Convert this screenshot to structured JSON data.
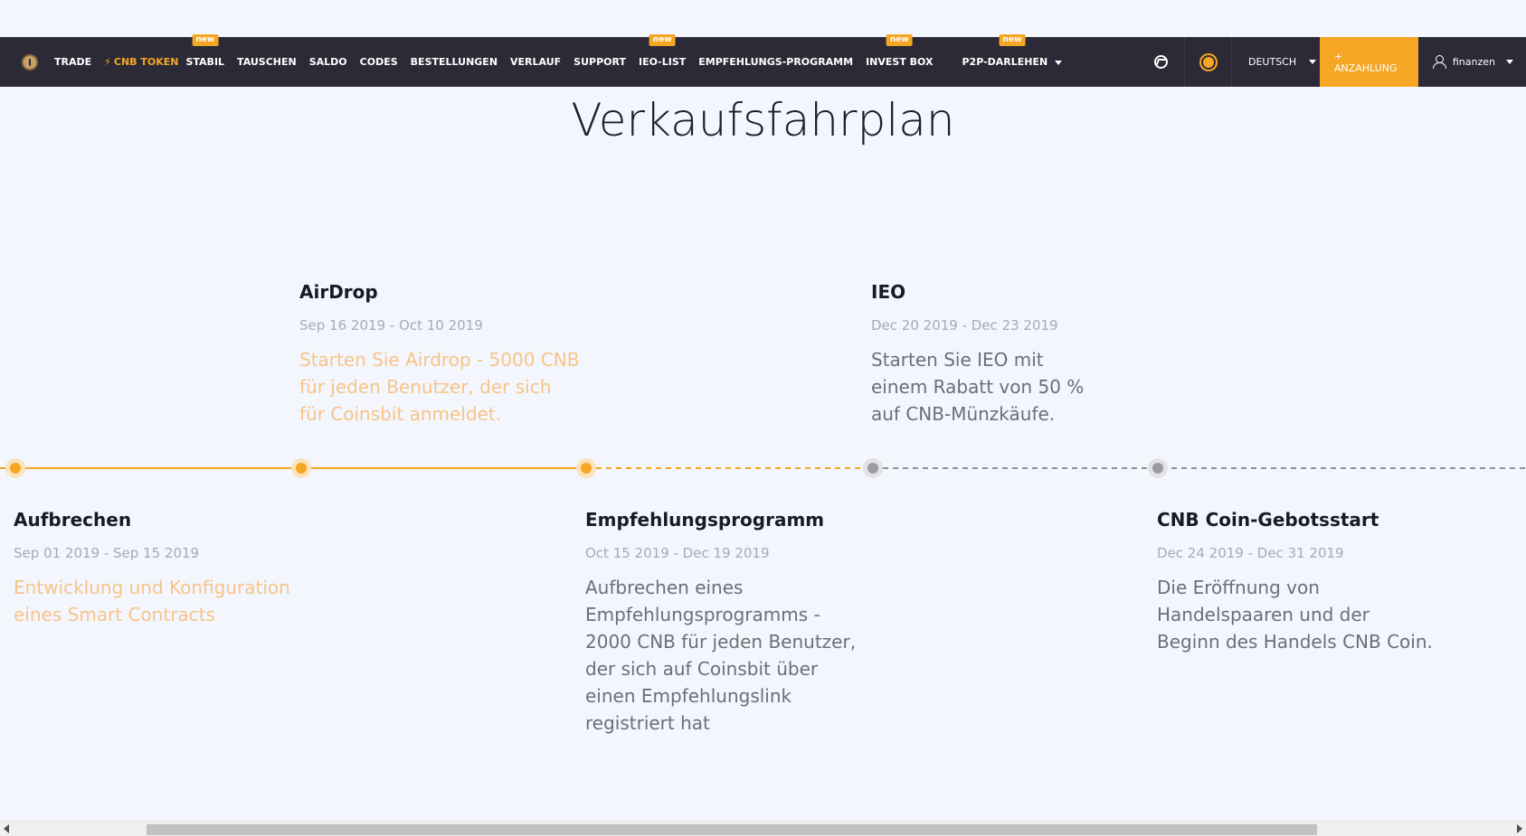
{
  "nav": {
    "items": [
      {
        "label": "TRADE"
      },
      {
        "label": "CNB TOKEN",
        "accent": true,
        "icon": "lightning-icon"
      },
      {
        "label": "STABIL",
        "badge": "new"
      },
      {
        "label": "TAUSCHEN"
      },
      {
        "label": "SALDO"
      },
      {
        "label": "CODES"
      },
      {
        "label": "BESTELLUNGEN"
      },
      {
        "label": "VERLAUF"
      },
      {
        "label": "SUPPORT"
      },
      {
        "label": "IEO-LIST",
        "badge": "new"
      },
      {
        "label": "EMPFEHLUNGS-PROGRAMM"
      },
      {
        "label": "INVEST BOX",
        "badge": "new"
      },
      {
        "label": "P2P-DARLEHEN",
        "badge": "new",
        "dropdown": true
      }
    ],
    "language": "DEUTSCH",
    "deposit": "+ ANZAHLUNG",
    "user": "finanzen",
    "lightning_glyph": "⚡"
  },
  "page": {
    "title": "Verkaufsfahrplan"
  },
  "timeline": {
    "milestones": [
      {
        "title": "Aufbrechen",
        "dates": "Sep 01 2019 - Sep 15 2019",
        "description": "Entwicklung und Konfiguration eines Smart Contracts",
        "status": "done"
      },
      {
        "title": "AirDrop",
        "dates": "Sep 16 2019 - Oct 10 2019",
        "description": "Starten Sie Airdrop - 5000 CNB für jeden Benutzer, der sich für Coinsbit anmeldet.",
        "status": "done"
      },
      {
        "title": "Empfehlungsprogramm",
        "dates": "Oct 15 2019 - Dec 19 2019",
        "description": "Aufbrechen eines Empfehlungsprogramms - 2000 CNB für jeden Benutzer, der sich auf Coinsbit über einen Empfehlungslink registriert hat",
        "status": "current"
      },
      {
        "title": "IEO",
        "dates": "Dec 20 2019 - Dec 23 2019",
        "description": "Starten Sie IEO mit einem Rabatt von 50 % auf CNB-Münzkäufe.",
        "status": "upcoming"
      },
      {
        "title": "CNB Coin-Gebotsstart",
        "dates": "Dec 24 2019 - Dec 31 2019",
        "description": "Die Eröffnung von Handelspaaren und der Beginn des Handels CNB Coin.",
        "status": "upcoming"
      }
    ]
  },
  "colors": {
    "accent": "#f5a623",
    "navbar": "#2b2a36",
    "background": "#f3f6fd",
    "upcoming": "#9a9aa2"
  }
}
